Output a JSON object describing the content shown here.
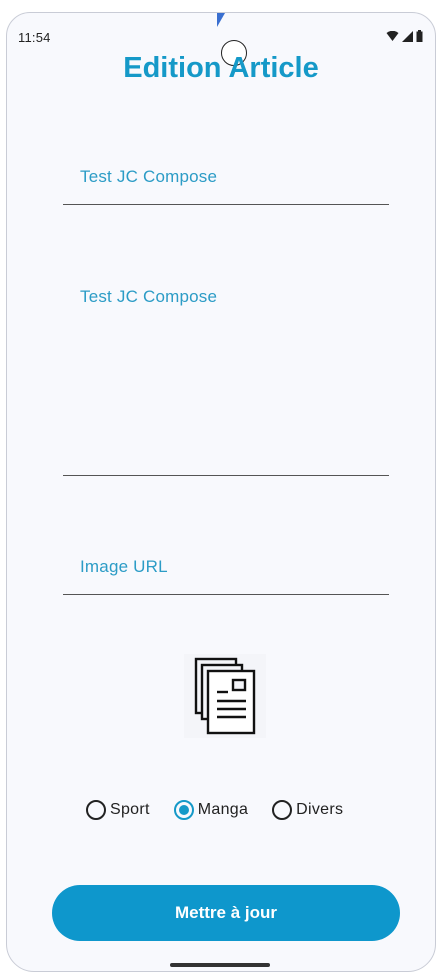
{
  "status_bar": {
    "time": "11:54",
    "icons": [
      "wifi-icon",
      "signal-icon",
      "battery-icon"
    ]
  },
  "header": {
    "title": "Edition Article"
  },
  "form": {
    "title_field": {
      "value": "Test JC Compose"
    },
    "description_field": {
      "value": "Test JC Compose"
    },
    "image_url_field": {
      "placeholder": "Image URL"
    },
    "image": {
      "icon": "document-icon"
    },
    "categories": {
      "options": [
        "Sport",
        "Manga",
        "Divers"
      ],
      "selected": "Manga"
    },
    "submit_label": "Mettre à jour"
  },
  "colors": {
    "accent": "#1599c8",
    "button": "#0e97cc",
    "background": "#f8f9fd"
  }
}
